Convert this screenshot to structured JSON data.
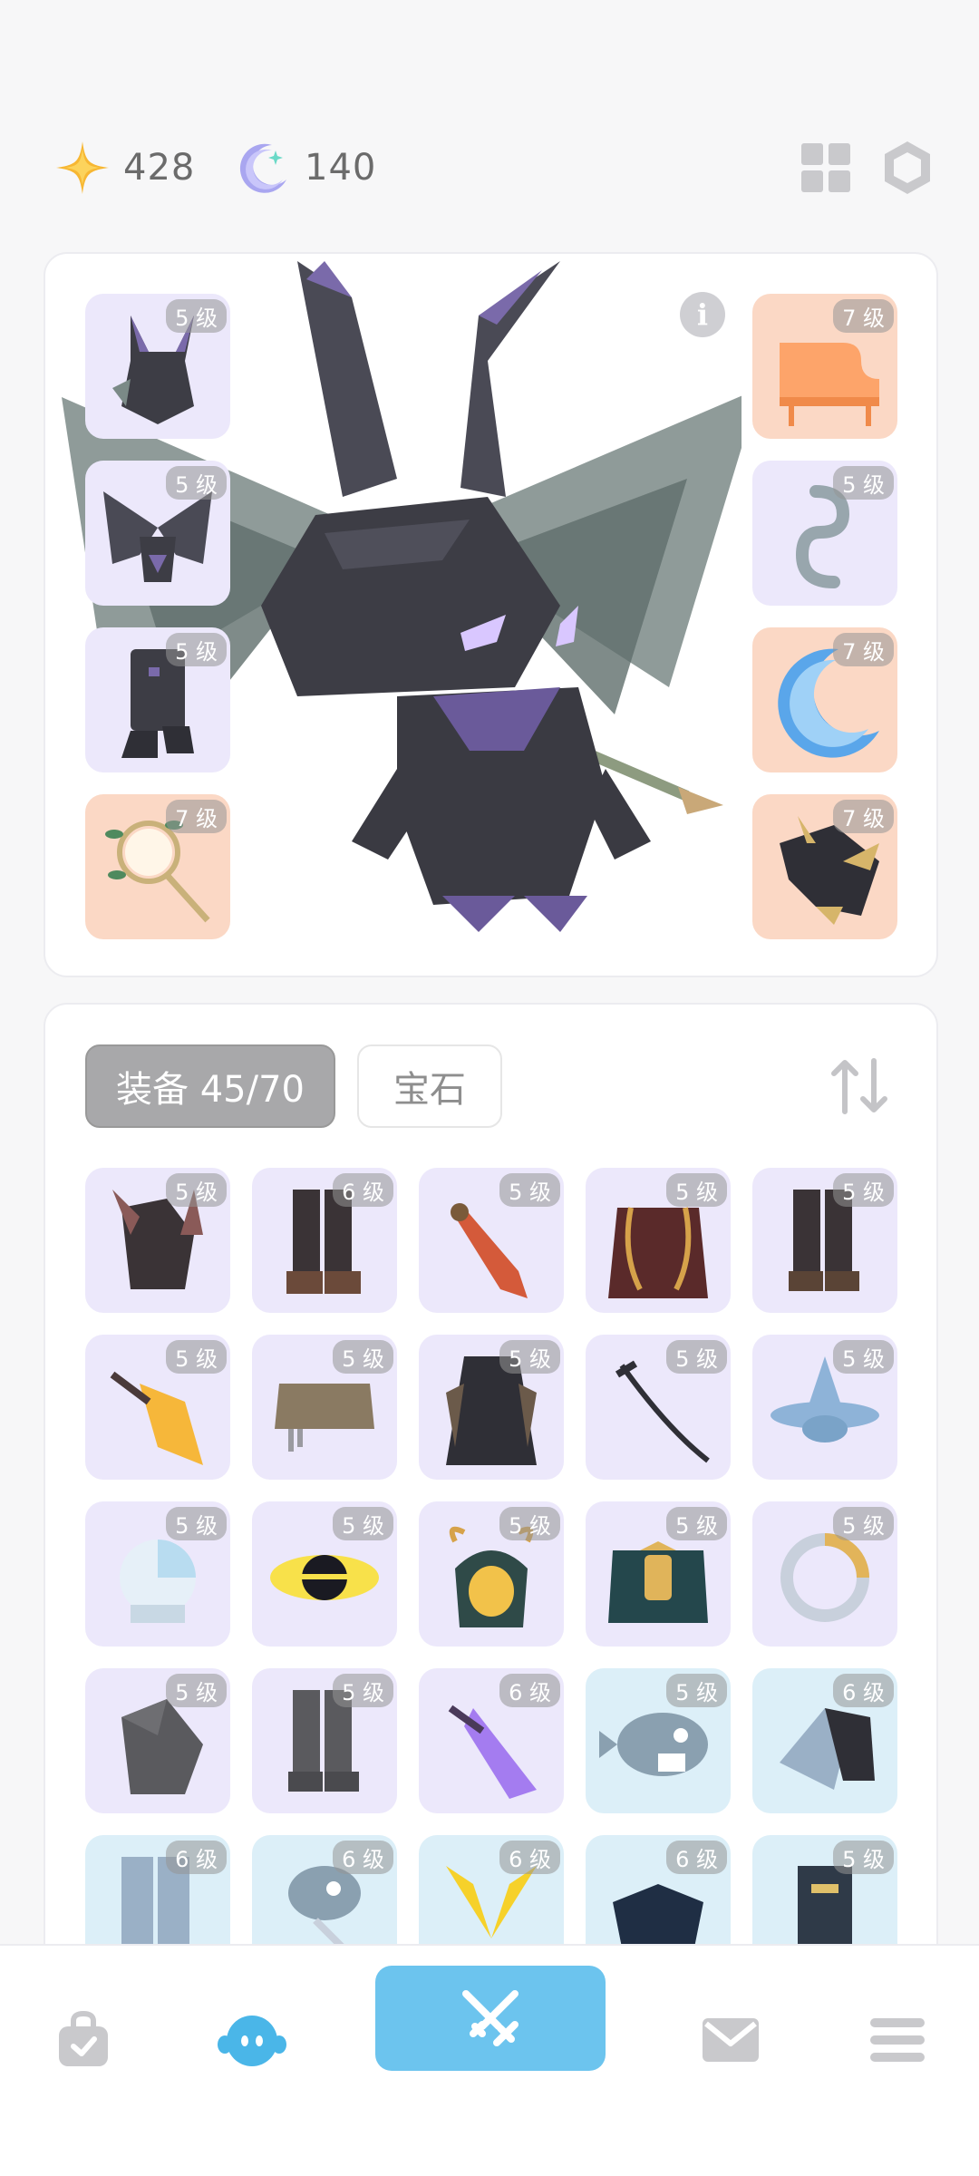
{
  "currency": {
    "stars": "428",
    "moons": "140"
  },
  "hero": {
    "left_slots": [
      {
        "level": "5 级",
        "bg": "purple",
        "icon": "demon-helmet-icon"
      },
      {
        "level": "5 级",
        "bg": "purple",
        "icon": "bat-wings-icon"
      },
      {
        "level": "5 级",
        "bg": "purple",
        "icon": "dark-boots-icon"
      },
      {
        "level": "7 级",
        "bg": "orange",
        "icon": "dreamcatcher-staff-icon"
      }
    ],
    "right_slots": [
      {
        "level": "7 级",
        "bg": "orange",
        "icon": "piano-icon"
      },
      {
        "level": "5 级",
        "bg": "purple",
        "icon": "chain-icon"
      },
      {
        "level": "7 级",
        "bg": "orange",
        "icon": "crescent-moon-icon"
      },
      {
        "level": "7 级",
        "bg": "orange",
        "icon": "dragon-head-icon"
      }
    ],
    "info_glyph": "i"
  },
  "inventory": {
    "tab_equipment": "装备 45/70",
    "tab_gems": "宝石",
    "items": [
      {
        "level": "5 级",
        "bg": "purple",
        "icon": "bat-hood-icon"
      },
      {
        "level": "6 级",
        "bg": "purple",
        "icon": "black-boots-icon"
      },
      {
        "level": "5 级",
        "bg": "purple",
        "icon": "red-sword-icon"
      },
      {
        "level": "5 级",
        "bg": "purple",
        "icon": "red-cape-icon"
      },
      {
        "level": "5 级",
        "bg": "purple",
        "icon": "dark-boots-icon"
      },
      {
        "level": "5 级",
        "bg": "purple",
        "icon": "golden-dagger-icon"
      },
      {
        "level": "5 级",
        "bg": "purple",
        "icon": "straw-skirt-icon"
      },
      {
        "level": "5 级",
        "bg": "purple",
        "icon": "dark-cloak-icon"
      },
      {
        "level": "5 级",
        "bg": "purple",
        "icon": "katana-icon"
      },
      {
        "level": "5 级",
        "bg": "purple",
        "icon": "spinning-top-icon"
      },
      {
        "level": "5 级",
        "bg": "purple",
        "icon": "space-helmet-icon"
      },
      {
        "level": "5 级",
        "bg": "purple",
        "icon": "black-hole-icon"
      },
      {
        "level": "5 级",
        "bg": "purple",
        "icon": "antler-mask-icon"
      },
      {
        "level": "5 级",
        "bg": "purple",
        "icon": "green-tunic-icon"
      },
      {
        "level": "5 级",
        "bg": "purple",
        "icon": "ouroboros-icon"
      },
      {
        "level": "5 级",
        "bg": "purple",
        "icon": "rock-icon"
      },
      {
        "level": "5 级",
        "bg": "purple",
        "icon": "grey-boots-icon"
      },
      {
        "level": "6 级",
        "bg": "purple",
        "icon": "crystal-sword-icon"
      },
      {
        "level": "5 级",
        "bg": "blue",
        "icon": "fish-head-icon"
      },
      {
        "level": "6 级",
        "bg": "blue",
        "icon": "fin-armor-icon"
      },
      {
        "level": "6 级",
        "bg": "blue",
        "icon": "blue-pants-icon"
      },
      {
        "level": "6 级",
        "bg": "blue",
        "icon": "fish-skeleton-icon"
      },
      {
        "level": "6 级",
        "bg": "blue",
        "icon": "lightning-wings-icon"
      },
      {
        "level": "6 级",
        "bg": "blue",
        "icon": "claw-armor-icon"
      },
      {
        "level": "5 级",
        "bg": "blue",
        "icon": "dark-leg-armor-icon"
      }
    ]
  },
  "nav": {
    "items": [
      "shop-bag-icon",
      "character-icon",
      "battle-swords-icon",
      "mail-icon",
      "menu-icon"
    ]
  },
  "colors": {
    "accent": "#6cc4ee",
    "purple_slot": "#ece8fb",
    "orange_slot": "#fbd8c5",
    "blue_slot": "#dceff8"
  }
}
